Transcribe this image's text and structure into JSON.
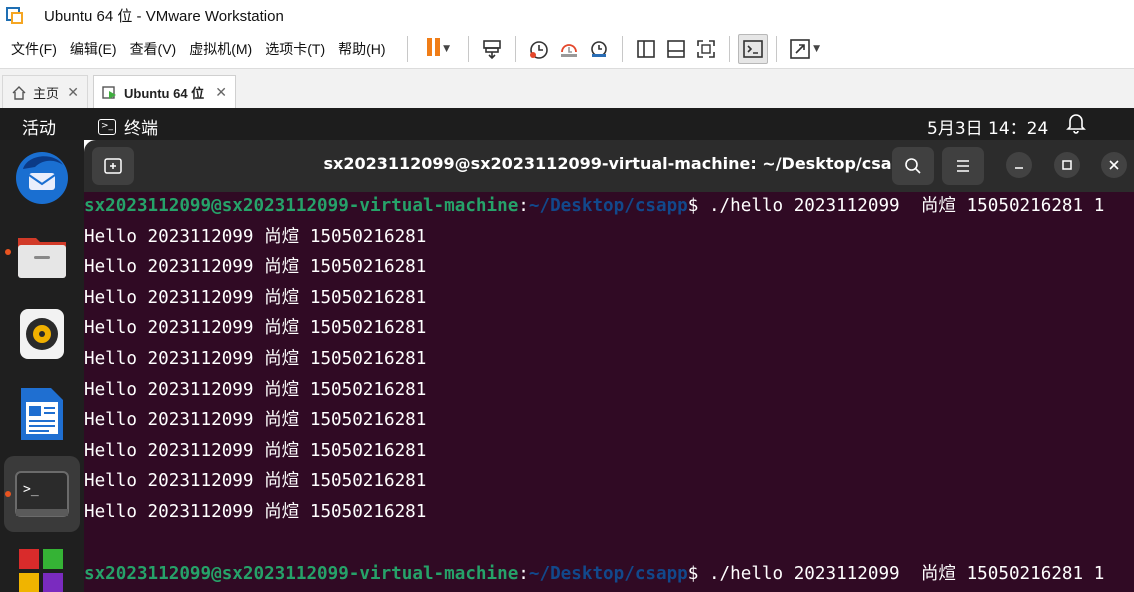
{
  "window": {
    "title": "Ubuntu 64 位 - VMware Workstation"
  },
  "menu": [
    "文件(F)",
    "编辑(E)",
    "查看(V)",
    "虚拟机(M)",
    "选项卡(T)",
    "帮助(H)"
  ],
  "tabs": [
    {
      "label": "主页"
    },
    {
      "label": "Ubuntu 64 位"
    }
  ],
  "gnome": {
    "activities": "活动",
    "app_name": "终端",
    "clock": "5月3日  14：24"
  },
  "terminal": {
    "title": "sx2023112099@sx2023112099-virtual-machine: ~/Desktop/csapp",
    "prompt_user": "sx2023112099@sx2023112099-virtual-machine",
    "prompt_sep": ":",
    "prompt_path": "~/Desktop/csapp",
    "prompt_dollar": "$",
    "command": " ./hello 2023112099  尚煊 15050216281 1",
    "output_lines": [
      "Hello 2023112099 尚煊 15050216281",
      "Hello 2023112099 尚煊 15050216281",
      "Hello 2023112099 尚煊 15050216281",
      "Hello 2023112099 尚煊 15050216281",
      "Hello 2023112099 尚煊 15050216281",
      "Hello 2023112099 尚煊 15050216281",
      "Hello 2023112099 尚煊 15050216281",
      "Hello 2023112099 尚煊 15050216281",
      "Hello 2023112099 尚煊 15050216281",
      "Hello 2023112099 尚煊 15050216281"
    ],
    "command2": " ./hello 2023112099  尚煊 15050216281 1"
  },
  "icons": {
    "toolbar": [
      "pause-icon",
      "send-keys-icon",
      "snapshot-icon",
      "revert-snapshot-icon",
      "snapshot-manager-icon",
      "sidebar-view-icon",
      "console-view-icon",
      "fullscreen-icon",
      "terminal-view-icon",
      "stretch-icon"
    ],
    "dock": [
      "thunderbird-icon",
      "files-icon",
      "rhythmbox-icon",
      "libreoffice-writer-icon",
      "terminal-icon",
      "app-grid-icon"
    ]
  },
  "colors": {
    "terminal_bg": "#300a24",
    "prompt_user": "#26a269",
    "prompt_path": "#12488b",
    "accent": "#e95420",
    "pause": "#f07d17"
  }
}
